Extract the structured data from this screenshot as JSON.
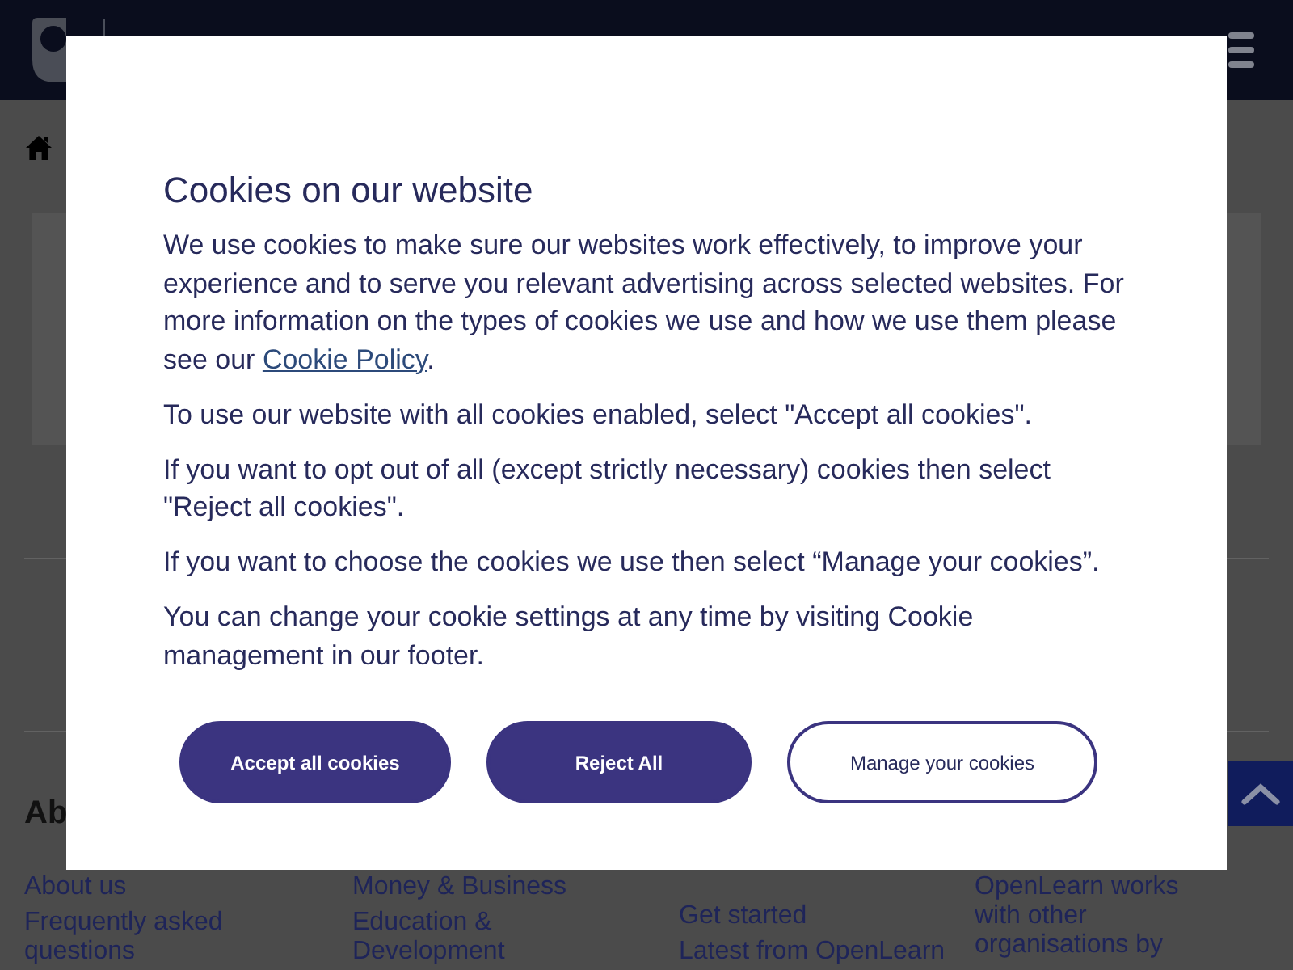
{
  "cookie_dialog": {
    "title": "Cookies on our website",
    "paragraphs": [
      {
        "kind": "with_link",
        "before": "We use cookies to make sure our websites work effectively, to improve your experience and to serve you relevant advertising across selected websites. For more information on the types of cookies we use and how we use them please see our ",
        "link": "Cookie Policy",
        "after": "."
      },
      {
        "kind": "plain",
        "text": "To use our website with all cookies enabled, select \"Accept all cookies\"."
      },
      {
        "kind": "plain",
        "text": "If you want to opt out of all (except strictly necessary) cookies then select \"Reject all cookies\"."
      },
      {
        "kind": "plain",
        "text": "If you want to choose the cookies we use then select “Manage your cookies”."
      },
      {
        "kind": "plain",
        "text": "You can change your cookie settings at any time by visiting Cookie management in our footer."
      }
    ],
    "buttons": [
      {
        "label": "Accept all cookies",
        "kind": "primary"
      },
      {
        "label": "Reject All",
        "kind": "primary"
      },
      {
        "label": "Manage your cookies",
        "kind": "secondary"
      }
    ]
  },
  "footer": {
    "heading": "Ab",
    "columns": [
      {
        "kind": "links",
        "items": [
          "About us",
          "Frequently asked questions"
        ]
      },
      {
        "kind": "links",
        "items": [
          "Money & Business",
          "Education & Development"
        ]
      },
      {
        "kind": "links",
        "items": [
          "Get started",
          "Latest from OpenLearn"
        ]
      },
      {
        "kind": "text",
        "text": "OpenLearn works with other organisations by"
      }
    ]
  }
}
